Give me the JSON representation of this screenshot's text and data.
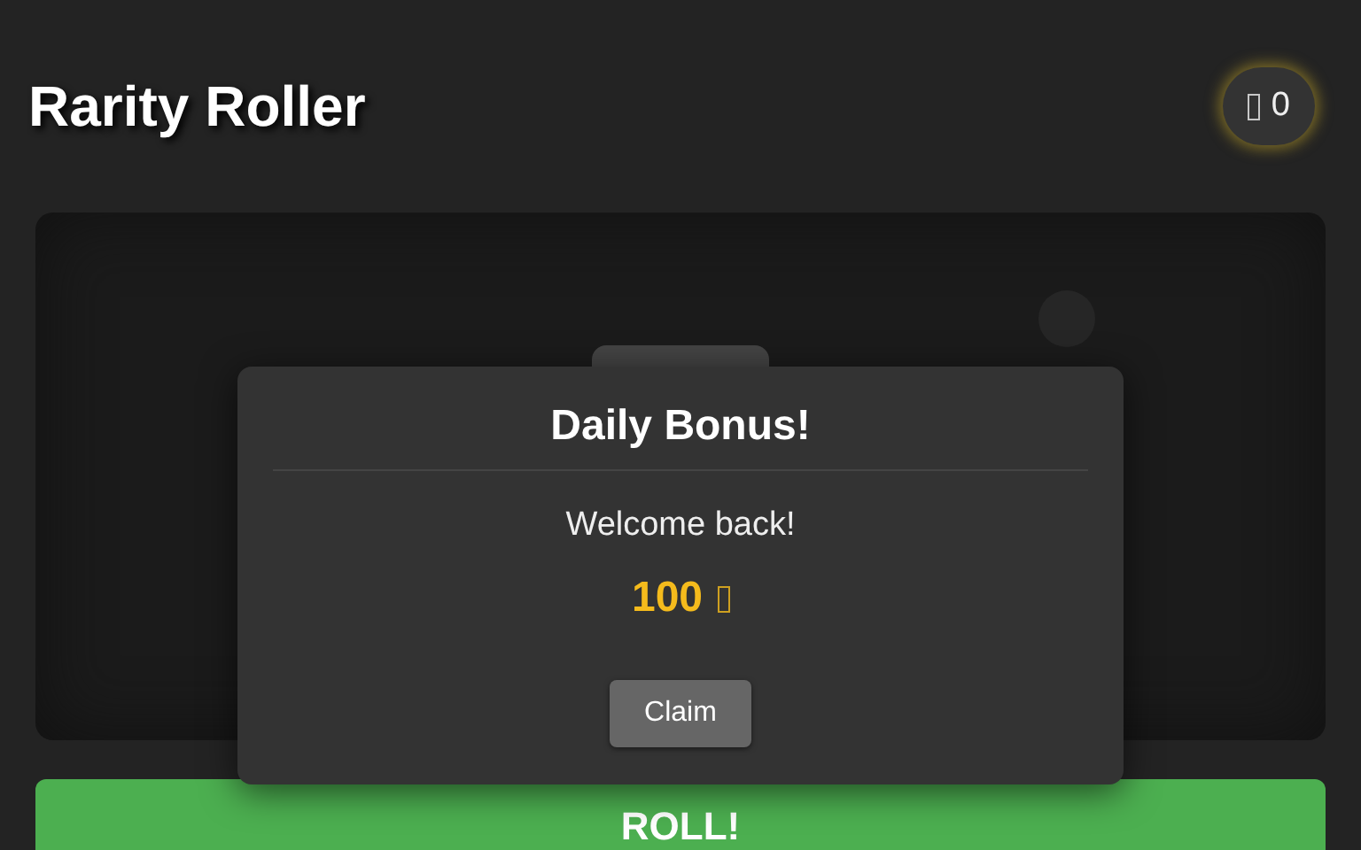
{
  "header": {
    "title": "Rarity Roller",
    "coins": "0"
  },
  "modal": {
    "title": "Daily Bonus!",
    "message": "Welcome back!",
    "reward": "100",
    "button": "Claim"
  },
  "roll_button": "ROLL!"
}
